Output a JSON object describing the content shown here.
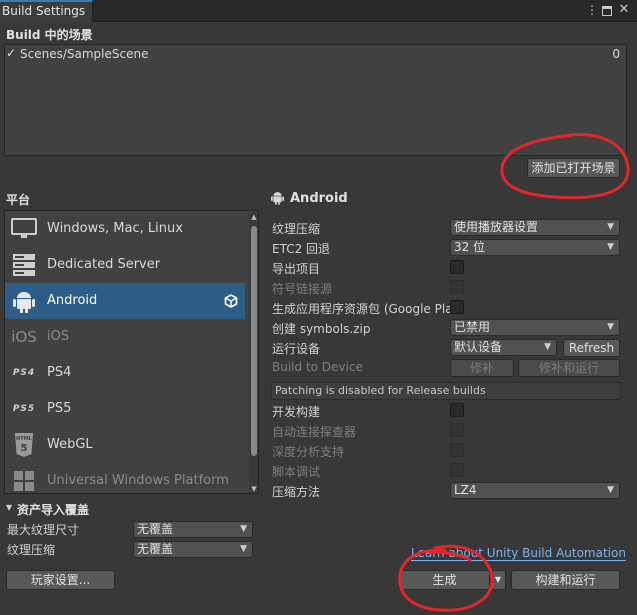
{
  "window": {
    "tab_title": "Build Settings",
    "menu_icon": "kebab-menu-icon",
    "maximize_icon": "maximize-icon",
    "close_icon": "close-icon"
  },
  "scenes": {
    "header": "Build 中的场景",
    "items": [
      {
        "checked": true,
        "name": "Scenes/SampleScene",
        "index": "0"
      }
    ],
    "add_open_scenes_label": "添加已打开场景"
  },
  "platform": {
    "header": "平台",
    "items": [
      {
        "label": "Windows, Mac, Linux",
        "icon": "monitor-icon",
        "selected": false,
        "dim": false
      },
      {
        "label": "Dedicated Server",
        "icon": "server-icon",
        "selected": false,
        "dim": false
      },
      {
        "label": "Android",
        "icon": "android-icon",
        "selected": true,
        "dim": false,
        "active_badge": "unity-logo-icon"
      },
      {
        "label": "iOS",
        "icon": "ios-icon",
        "icon_text": "iOS",
        "selected": false,
        "dim": true
      },
      {
        "label": "PS4",
        "icon": "ps4-icon",
        "icon_text": "PS4",
        "selected": false,
        "dim": false
      },
      {
        "label": "PS5",
        "icon": "ps5-icon",
        "icon_text": "PS5",
        "selected": false,
        "dim": false
      },
      {
        "label": "WebGL",
        "icon": "html5-icon",
        "icon_text": "HTML",
        "selected": false,
        "dim": false
      },
      {
        "label": "Universal Windows Platform",
        "icon": "windows-logo-icon",
        "selected": false,
        "dim": true
      }
    ]
  },
  "android": {
    "title": "Android",
    "settings": [
      {
        "label": "纹理压缩",
        "type": "dropdown",
        "value": "使用播放器设置",
        "dim": false
      },
      {
        "label": "ETC2 回退",
        "type": "dropdown",
        "value": "32 位",
        "dim": false
      },
      {
        "label": "导出项目",
        "type": "checkbox",
        "checked": false,
        "dim": false
      },
      {
        "label": "符号链接源",
        "type": "checkbox",
        "checked": false,
        "dim": true
      },
      {
        "label": "生成应用程序资源包 (Google Play)",
        "type": "checkbox",
        "checked": false,
        "dim": false
      },
      {
        "label": "创建 symbols.zip",
        "type": "dropdown",
        "value": "已禁用",
        "dim": false
      },
      {
        "label": "运行设备",
        "type": "dropdown",
        "value": "默认设备",
        "dim": false
      },
      {
        "label": "Build to Device",
        "type": "buttons",
        "dim": true
      },
      {
        "label": "开发构建",
        "type": "checkbox",
        "checked": false,
        "dim": false
      },
      {
        "label": "自动连接探查器",
        "type": "checkbox",
        "checked": false,
        "dim": true
      },
      {
        "label": "深度分析支持",
        "type": "checkbox",
        "checked": false,
        "dim": true
      },
      {
        "label": "脚本调试",
        "type": "checkbox",
        "checked": false,
        "dim": true
      },
      {
        "label": "压缩方法",
        "type": "dropdown",
        "value": "LZ4",
        "dim": false
      }
    ],
    "refresh_label": "Refresh",
    "patch_label": "修补",
    "patch_run_label": "修补和运行",
    "patch_message": "Patching is disabled for Release builds"
  },
  "asset_import": {
    "header": "资产导入覆盖",
    "rows": [
      {
        "label": "最大纹理尺寸",
        "value": "无覆盖"
      },
      {
        "label": "纹理压缩",
        "value": "无覆盖"
      }
    ]
  },
  "footer": {
    "learn_link": "Learn about Unity Build Automation",
    "player_settings_label": "玩家设置...",
    "build_label": "生成",
    "build_and_run_label": "构建和运行"
  },
  "colors": {
    "selection": "#2c5d87",
    "annotation_red": "#e3262b",
    "link": "#7ab3ef"
  }
}
